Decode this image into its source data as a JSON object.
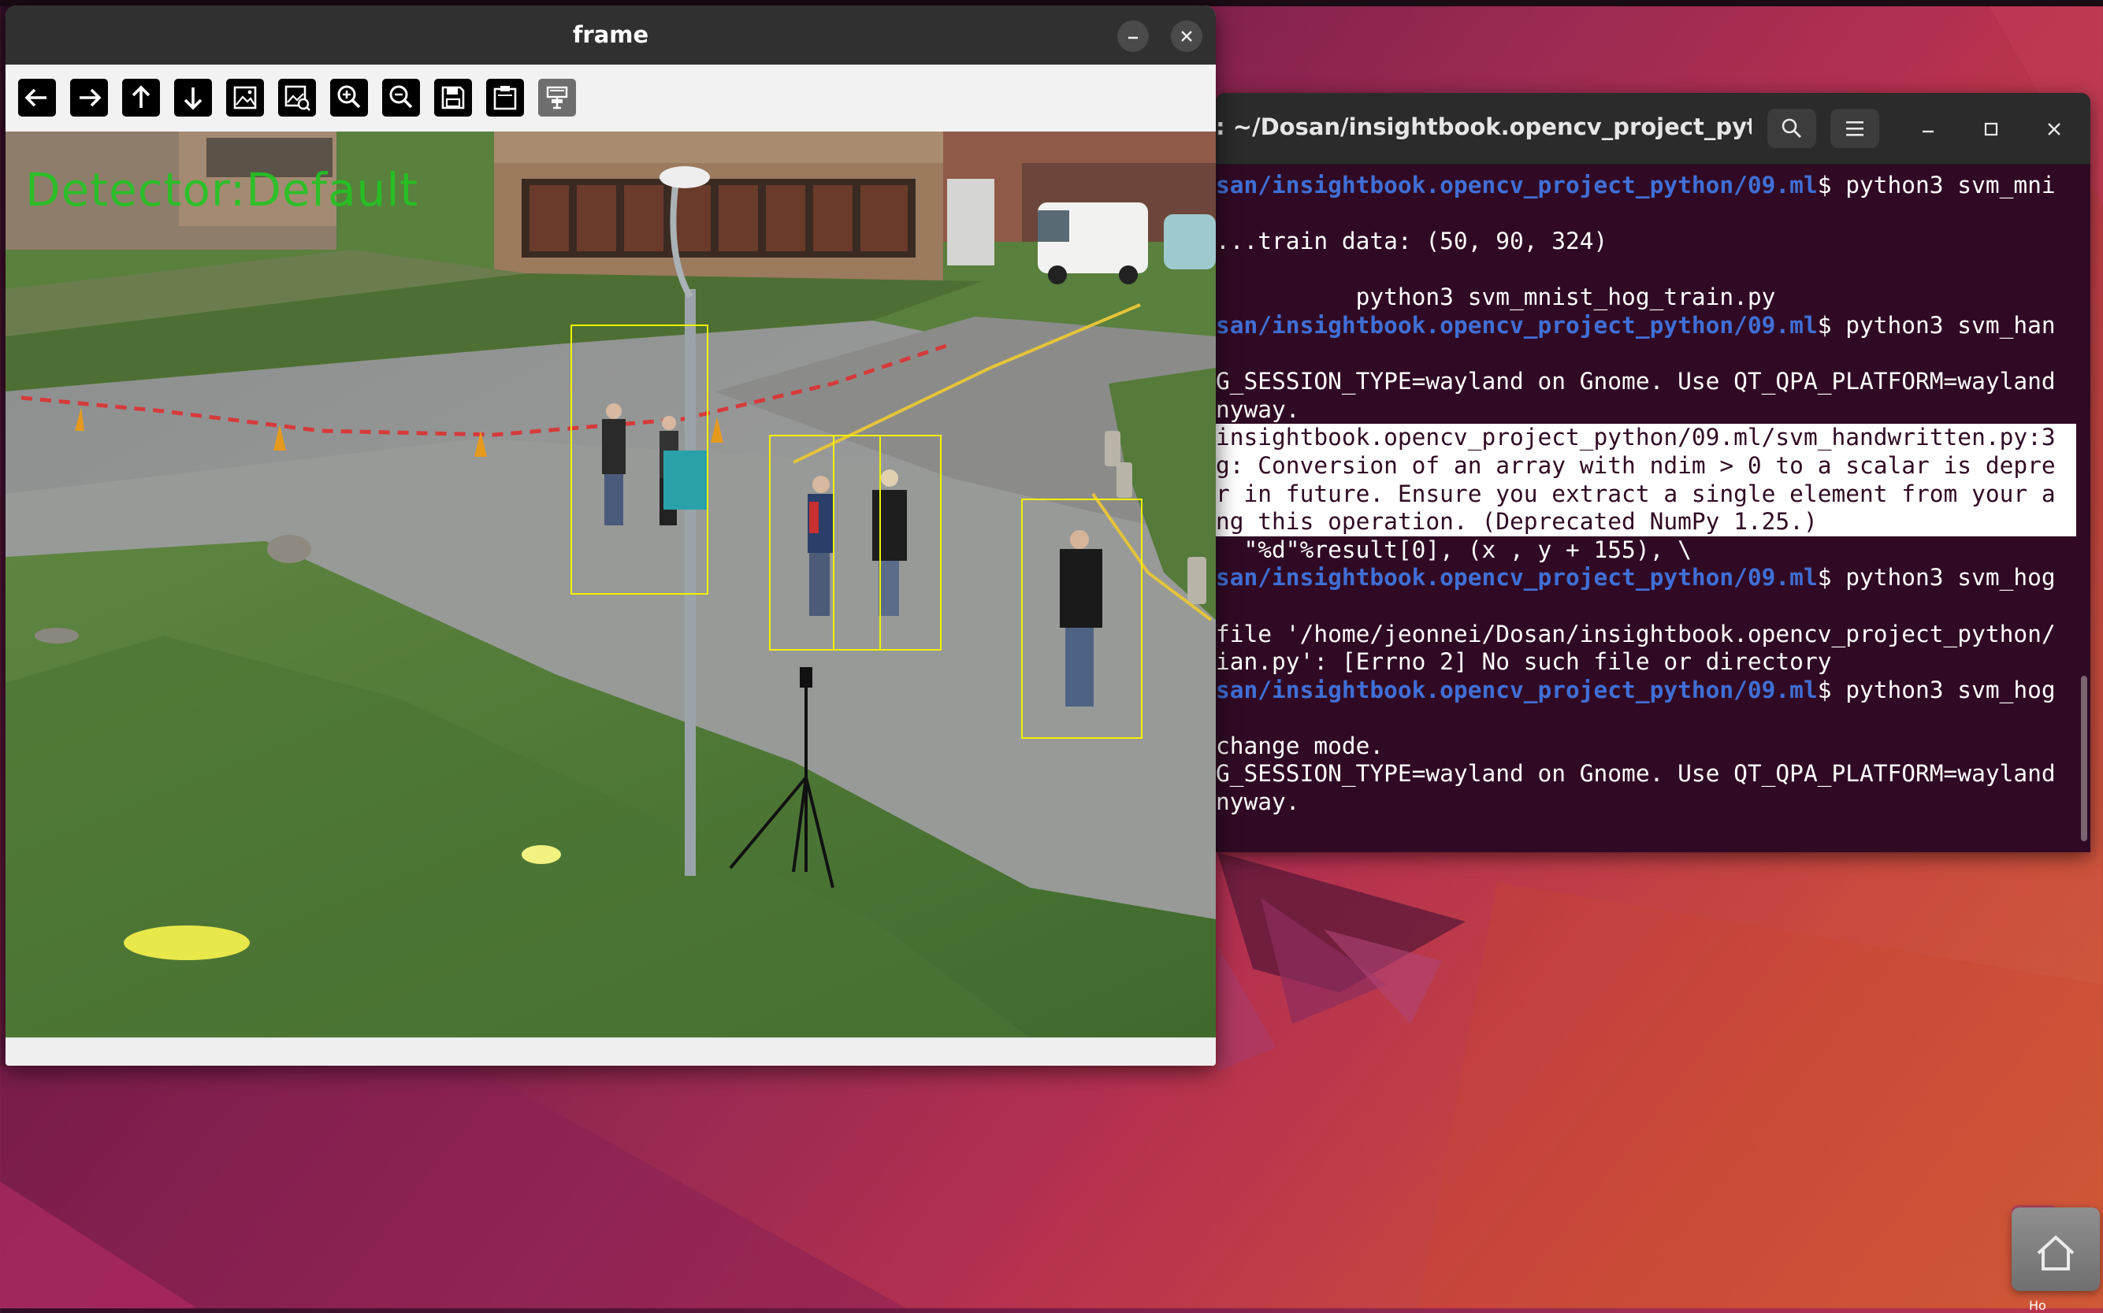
{
  "desktop": {
    "dock_icon": "home-folder-icon",
    "edge_text": "Ho"
  },
  "terminal": {
    "title": ": ~/Dosan/insightbook.opencv_project_pyth...",
    "buttons": {
      "search": "search-icon",
      "menu": "hamburger-menu-icon",
      "minimize": "minimize-icon",
      "maximize": "maximize-icon",
      "close": "close-icon"
    },
    "lines": [
      {
        "path": "san/insightbook.opencv_project_python/09.ml",
        "text": "$ python3 svm_mni",
        "selected": false
      },
      {
        "path": "",
        "text": "",
        "selected": false
      },
      {
        "path": "",
        "text": "...train data: (50, 90, 324)",
        "selected": false
      },
      {
        "path": "",
        "text": "",
        "selected": false
      },
      {
        "path": "",
        "text": "          python3 svm_mnist_hog_train.py",
        "selected": false
      },
      {
        "path": "san/insightbook.opencv_project_python/09.ml",
        "text": "$ python3 svm_han",
        "selected": false
      },
      {
        "path": "",
        "text": "",
        "selected": false
      },
      {
        "path": "",
        "text": "G_SESSION_TYPE=wayland on Gnome. Use QT_QPA_PLATFORM=wayland",
        "selected": false
      },
      {
        "path": "",
        "text": "nyway.",
        "selected": false
      },
      {
        "path": "",
        "text": "insightbook.opencv_project_python/09.ml/svm_handwritten.py:3",
        "selected": true
      },
      {
        "path": "",
        "text": "g: Conversion of an array with ndim > 0 to a scalar is depre",
        "selected": true
      },
      {
        "path": "",
        "text": "r in future. Ensure you extract a single element from your a",
        "selected": true
      },
      {
        "path": "",
        "text": "ng this operation. (Deprecated NumPy 1.25.)",
        "selected": true
      },
      {
        "path": "",
        "text": "  \"%d\"%result[0], (x , y + 155), \\",
        "selected": false
      },
      {
        "path": "san/insightbook.opencv_project_python/09.ml",
        "text": "$ python3 svm_hog",
        "selected": false
      },
      {
        "path": "",
        "text": "",
        "selected": false
      },
      {
        "path": "",
        "text": "file '/home/jeonnei/Dosan/insightbook.opencv_project_python/",
        "selected": false
      },
      {
        "path": "",
        "text": "ian.py': [Errno 2] No such file or directory",
        "selected": false
      },
      {
        "path": "san/insightbook.opencv_project_python/09.ml",
        "text": "$ python3 svm_hog",
        "selected": false
      },
      {
        "path": "",
        "text": "",
        "selected": false
      },
      {
        "path": "",
        "text": "change mode.",
        "selected": false
      },
      {
        "path": "",
        "text": "G_SESSION_TYPE=wayland on Gnome. Use QT_QPA_PLATFORM=wayland",
        "selected": false
      },
      {
        "path": "",
        "text": "nyway.",
        "selected": false
      }
    ]
  },
  "frame_window": {
    "title": "frame",
    "buttons": {
      "minimize": "minimize-icon",
      "close": "close-icon"
    },
    "toolbar": [
      {
        "icon": "arrow-left-icon",
        "label": "Pan left"
      },
      {
        "icon": "arrow-right-icon",
        "label": "Pan right"
      },
      {
        "icon": "arrow-up-icon",
        "label": "Pan up"
      },
      {
        "icon": "arrow-down-icon",
        "label": "Pan down"
      },
      {
        "icon": "image-icon",
        "label": "Zoom to original"
      },
      {
        "icon": "fit-image-icon",
        "label": "Zoom fit"
      },
      {
        "icon": "zoom-in-icon",
        "label": "Zoom in"
      },
      {
        "icon": "zoom-out-icon",
        "label": "Zoom out"
      },
      {
        "icon": "save-icon",
        "label": "Save"
      },
      {
        "icon": "clipboard-icon",
        "label": "Copy to clipboard"
      },
      {
        "icon": "properties-icon",
        "label": "Properties"
      }
    ],
    "overlay_text": "Detector:Default",
    "detections": 4
  },
  "colors": {
    "terminal_bg": "#300a24",
    "prompt_path": "#3f6fd6",
    "detector_text": "#22c522",
    "detection_box": "#f2f200"
  }
}
